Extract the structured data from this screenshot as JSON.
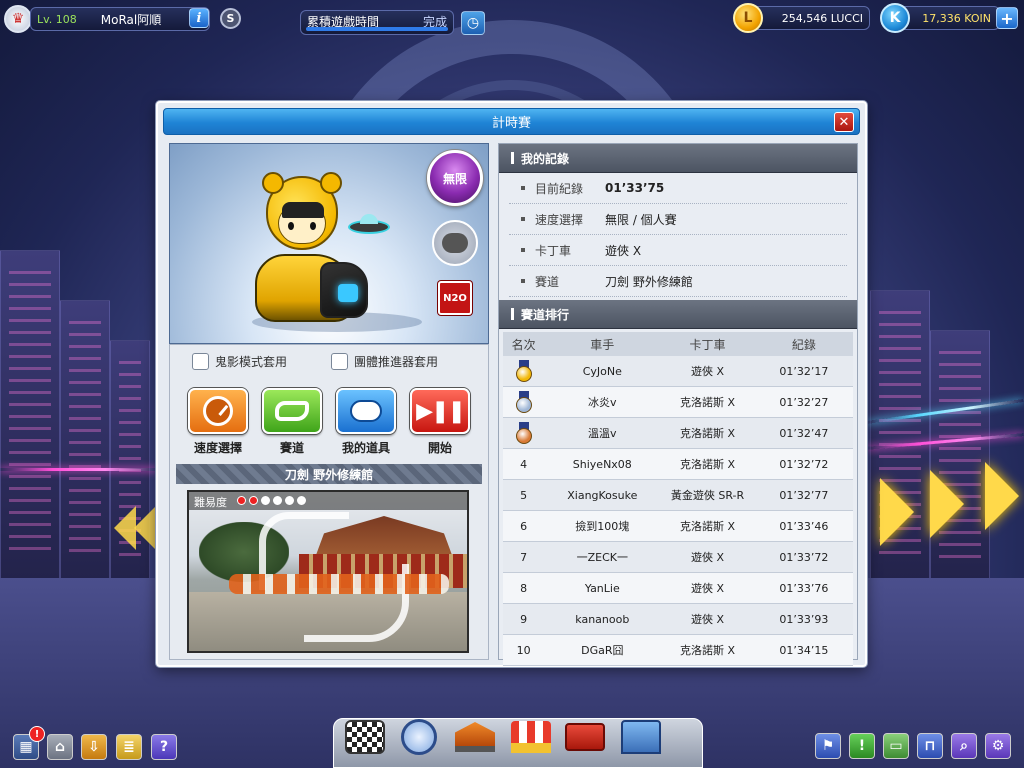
{
  "topbar": {
    "level": "Lv. 108",
    "player_name": "MoRal阿順",
    "info_icon": "i",
    "s_icon": "S",
    "play_time_label": "累積遊戲時間",
    "play_time_status": "完成",
    "lucci": "254,546 LUCCI",
    "lucci_icon": "L",
    "koin": "17,336 KOIN",
    "koin_icon": "K",
    "add_icon": "+"
  },
  "window": {
    "title": "計時賽",
    "close": "✕"
  },
  "kart": {
    "speed_badge": "無限",
    "n2o_badge": "N2O"
  },
  "options": {
    "ghost_mode": "鬼影模式套用",
    "team_booster": "團體推進器套用"
  },
  "actions": [
    {
      "label": "速度選擇",
      "icon": "speedometer-icon",
      "color": "#f08a1c"
    },
    {
      "label": "賽道",
      "icon": "track-icon",
      "color": "#5fbf2a"
    },
    {
      "label": "我的道具",
      "icon": "item-icon",
      "color": "#2a8ee0"
    },
    {
      "label": "開始",
      "icon": "play-pause-icon",
      "color": "#e0261c"
    }
  ],
  "track": {
    "name": "刀劍 野外修練館",
    "difficulty_label": "難易度",
    "difficulty": 2,
    "difficulty_max": 6
  },
  "my_record": {
    "header": "我的記錄",
    "rows": [
      {
        "label": "目前紀錄",
        "value": "01’33’75"
      },
      {
        "label": "速度選擇",
        "value": "無限 / 個人賽"
      },
      {
        "label": "卡丁車",
        "value": "遊俠 X"
      },
      {
        "label": "賽道",
        "value": "刀劍 野外修練館"
      }
    ]
  },
  "ranking": {
    "header": "賽道排行",
    "columns": [
      "名次",
      "車手",
      "卡丁車",
      "紀錄"
    ],
    "rows": [
      {
        "rank": "",
        "medal": "gold",
        "driver": "CyJoNe",
        "kart": "遊俠 X",
        "time": "01’32’17"
      },
      {
        "rank": "",
        "medal": "silver",
        "driver": "冰炎v",
        "kart": "克洛諾斯 X",
        "time": "01’32’27"
      },
      {
        "rank": "",
        "medal": "bronze",
        "driver": "溫溫v",
        "kart": "克洛諾斯 X",
        "time": "01’32’47"
      },
      {
        "rank": "4",
        "medal": "",
        "driver": "ShiyeNx08",
        "kart": "克洛諾斯 X",
        "time": "01’32’72"
      },
      {
        "rank": "5",
        "medal": "",
        "driver": "XiangKosuke",
        "kart": "黃金遊俠 SR-R",
        "time": "01’32’77"
      },
      {
        "rank": "6",
        "medal": "",
        "driver": "撿到100塊",
        "kart": "克洛諾斯 X",
        "time": "01’33’46"
      },
      {
        "rank": "7",
        "medal": "",
        "driver": "一ZECK一",
        "kart": "遊俠 X",
        "time": "01’33’72"
      },
      {
        "rank": "8",
        "medal": "",
        "driver": "YanLie",
        "kart": "遊俠 X",
        "time": "01’33’76"
      },
      {
        "rank": "9",
        "medal": "",
        "driver": "kananoob",
        "kart": "遊俠 X",
        "time": "01’33’93"
      },
      {
        "rank": "10",
        "medal": "",
        "driver": "DGaR囧",
        "kart": "克洛諾斯 X",
        "time": "01’34’15"
      }
    ]
  },
  "bottom_left": {
    "notify_badge": "!",
    "help_icon": "?"
  },
  "colors": {
    "title_blue": "#1f84d6",
    "gold": "#f2b705",
    "silver": "#9fb6d6",
    "bronze": "#d97a36"
  }
}
